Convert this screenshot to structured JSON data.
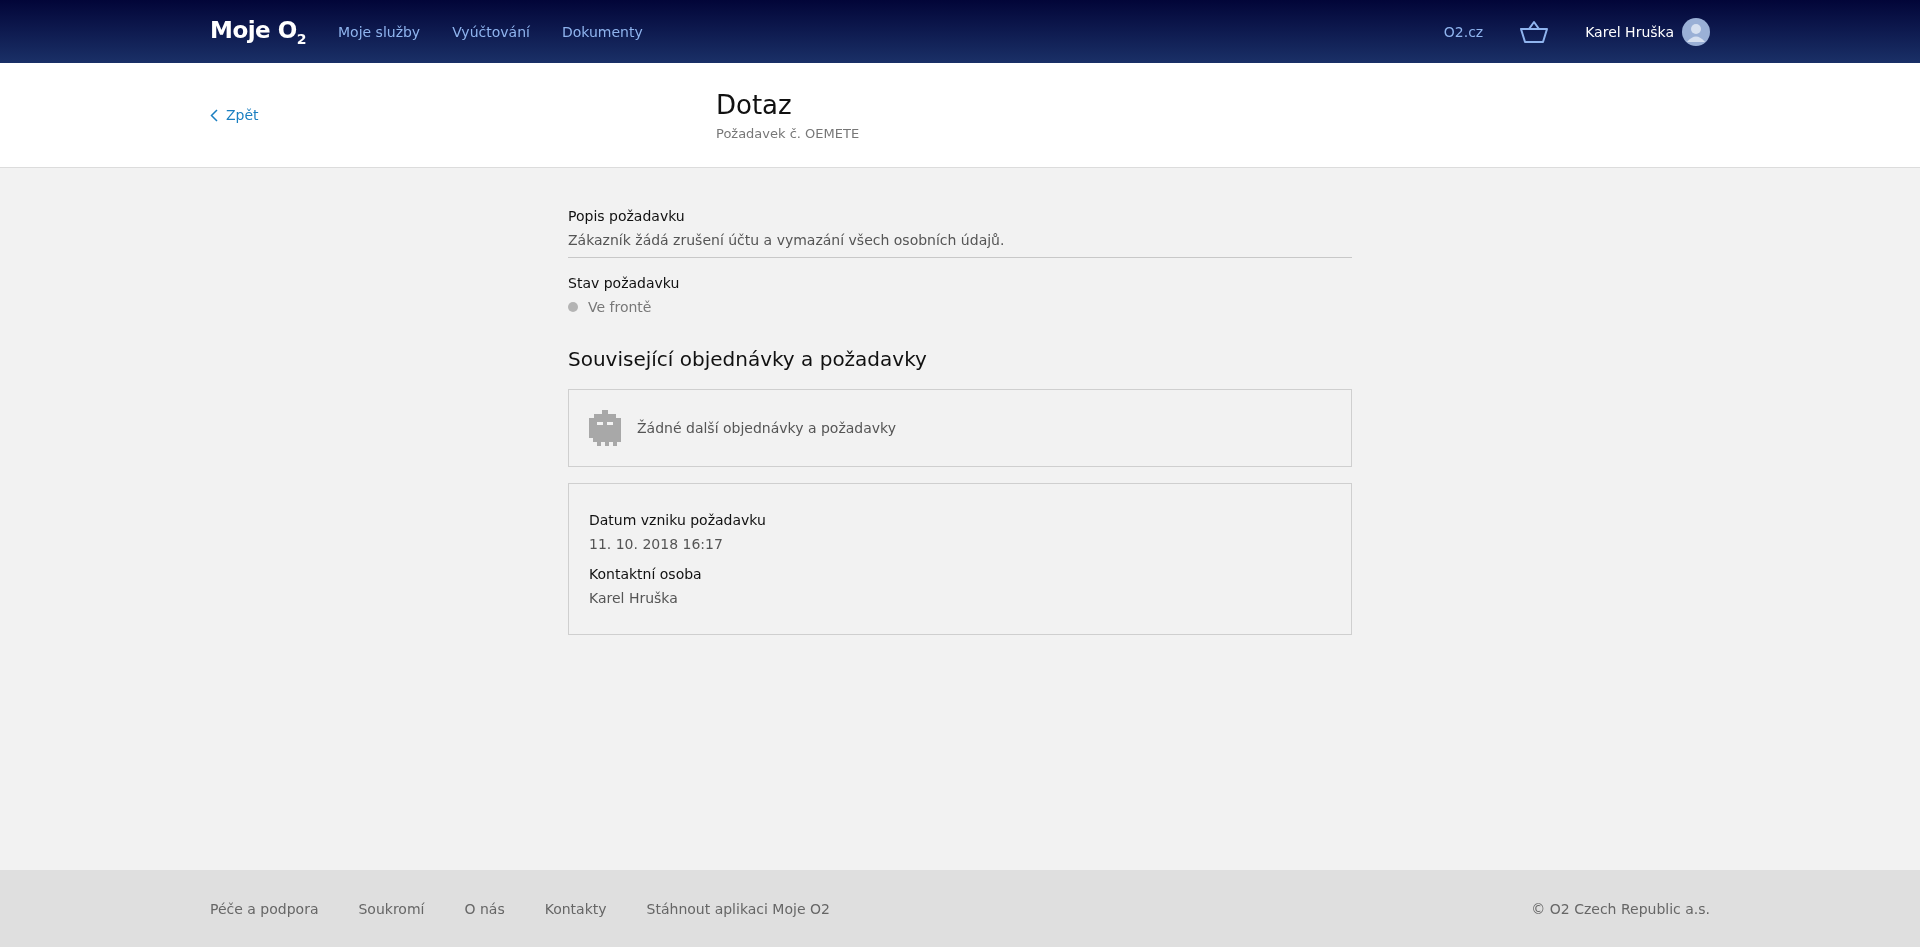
{
  "header": {
    "logo": "Moje O$_{2}$",
    "nav": [
      {
        "label": "Moje služby"
      },
      {
        "label": "Vyúčtování"
      },
      {
        "label": "Dokumenty"
      }
    ],
    "site_link": "O2.cz",
    "user_name": "Karel Hruška"
  },
  "subheader": {
    "back": "Zpět",
    "title": "Dotaz",
    "subtitle": "Požadavek č. OEMETE"
  },
  "description": {
    "label": "Popis požadavku",
    "value": "Zákazník žádá zrušení účtu a vymazání všech osobních údajů."
  },
  "status": {
    "label": "Stav požadavku",
    "value": "Ve frontě",
    "color": "#b4b4b4"
  },
  "related": {
    "title": "Související objednávky a požadavky",
    "empty_text": "Žádné další objednávky a požadavky"
  },
  "details": [
    {
      "label": "Datum vzniku požadavku",
      "value": "11. 10. 2018 16:17"
    },
    {
      "label": "Kontaktní osoba",
      "value": "Karel Hruška"
    }
  ],
  "footer": {
    "links": [
      {
        "label": "Péče a podpora"
      },
      {
        "label": "Soukromí"
      },
      {
        "label": "O nás"
      },
      {
        "label": "Kontakty"
      },
      {
        "label": "Stáhnout aplikaci Moje O2"
      }
    ],
    "copyright": "© O2 Czech Republic a.s."
  }
}
